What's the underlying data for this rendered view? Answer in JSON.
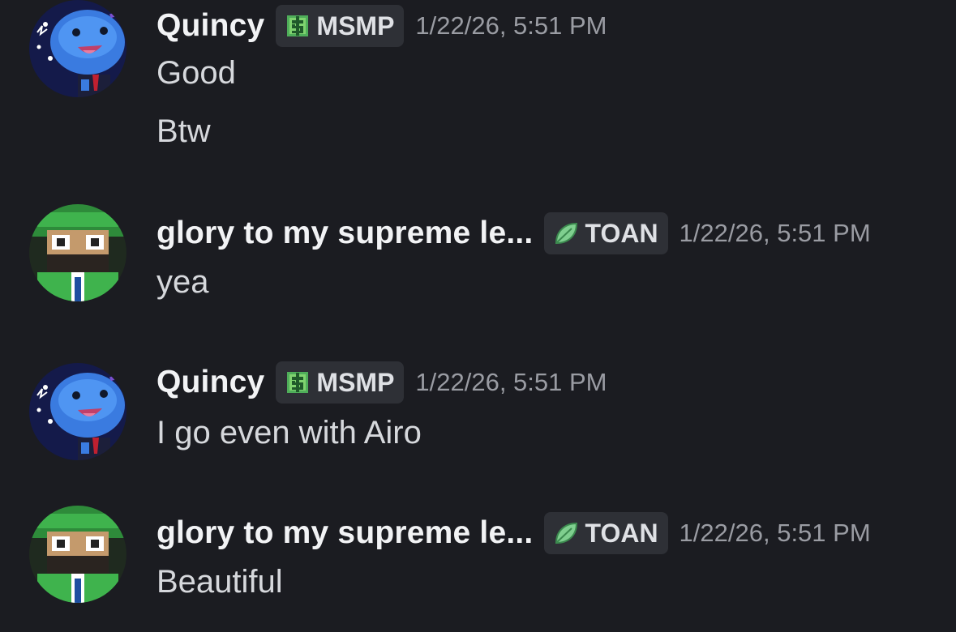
{
  "messages": [
    {
      "author": "Quincy",
      "avatar": "blue-creature-avatar",
      "tag": {
        "icon": "dollar-pixel-icon",
        "label": "MSMP"
      },
      "timestamp": "1/22/26, 5:51 PM",
      "lines": [
        "Good",
        "Btw"
      ]
    },
    {
      "author": "glory to my supreme le...",
      "avatar": "green-cap-pixel-avatar",
      "tag": {
        "icon": "leaf-icon",
        "label": "TOAN"
      },
      "timestamp": "1/22/26, 5:51 PM",
      "lines": [
        "yea"
      ]
    },
    {
      "author": "Quincy",
      "avatar": "blue-creature-avatar",
      "tag": {
        "icon": "dollar-pixel-icon",
        "label": "MSMP"
      },
      "timestamp": "1/22/26, 5:51 PM",
      "lines": [
        "I go even with Airo"
      ]
    },
    {
      "author": "glory to my supreme le...",
      "avatar": "green-cap-pixel-avatar",
      "tag": {
        "icon": "leaf-icon",
        "label": "TOAN"
      },
      "timestamp": "1/22/26, 5:51 PM",
      "lines": [
        "Beautiful"
      ]
    }
  ],
  "colors": {
    "background": "#1b1c21",
    "tag_background": "#2e3036",
    "username": "#f2f3f5",
    "timestamp": "#9a9ca3",
    "message_text": "#d6d8dc"
  }
}
